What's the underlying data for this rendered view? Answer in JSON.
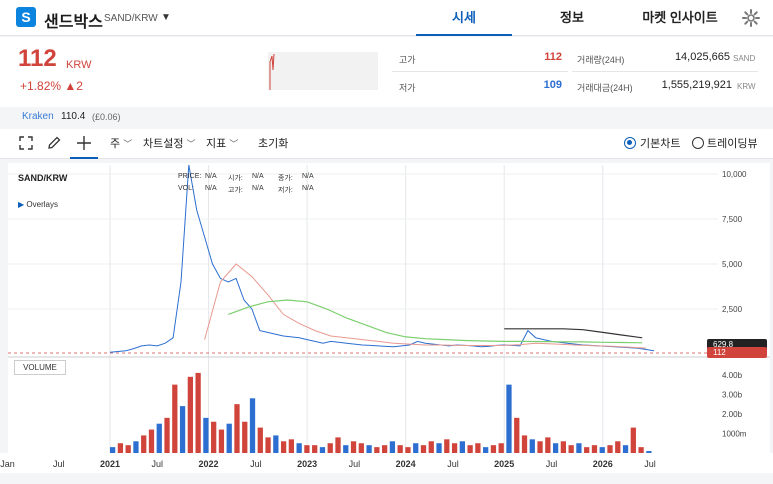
{
  "header": {
    "logo_letter": "S",
    "coin_name": "샌드박스",
    "pair": "SAND/KRW",
    "tabs": [
      {
        "label": "시세",
        "active": true
      },
      {
        "label": "정보",
        "active": false
      },
      {
        "label": "마켓 인사이트",
        "active": false
      }
    ],
    "settings_icon": "gear-icon"
  },
  "summary": {
    "price": "112",
    "price_unit": "KRW",
    "change": "+1.82% ▲2",
    "high_label": "고가",
    "high_value": "112",
    "low_label": "저가",
    "low_value": "109",
    "volume_label": "거래량(24H)",
    "volume_value": "14,025,665",
    "volume_unit": "SAND",
    "amount_label": "거래대금(24H)",
    "amount_value": "1,555,219,921",
    "amount_unit": "KRW"
  },
  "exchange": {
    "name": "Kraken",
    "price": "110.4",
    "diff": "(£0.06)"
  },
  "toolbar": {
    "period": "주",
    "chart_settings": "차트설정",
    "indicators": "지표",
    "reset": "초기화",
    "radio_basic": "기본차트",
    "radio_trading": "트레이딩뷰",
    "colors": {
      "accent": "#0b5fbb",
      "up": "#d0443b",
      "down": "#2c6fd1"
    }
  },
  "chart": {
    "symbol": "SAND/KRW",
    "overlays": "Overlays",
    "ohlc": {
      "price_label": "PRICE:",
      "price": "N/A",
      "open_label": "시가:",
      "open": "N/A",
      "close_label": "종가:",
      "close": "N/A",
      "vol_label": "VOL:",
      "vol": "N/A",
      "high_label": "고가:",
      "high": "N/A",
      "low_label": "저가:",
      "low": "N/A"
    },
    "volume_label": "VOLUME",
    "price_tag_1": "629.8",
    "price_tag_2": "112"
  },
  "chart_data": {
    "type": "line",
    "price_axis_ticks": [
      "10,000",
      "7,500",
      "5,000",
      "2,500"
    ],
    "volume_axis_ticks": [
      "4.00b",
      "3.00b",
      "2.00b",
      "1000m"
    ],
    "x_ticks": [
      "Jan",
      "Jul",
      "2021",
      "Jul",
      "2022",
      "Jul",
      "2023",
      "Jul",
      "2024",
      "Jul",
      "2025",
      "Jul",
      "2026",
      "Jul"
    ],
    "ylim": [
      0,
      10500
    ],
    "series": [
      {
        "x": [
          0,
          4,
          8,
          12,
          16,
          20,
          24,
          28,
          32,
          36,
          40,
          44,
          48,
          52,
          56,
          60,
          64,
          68,
          72,
          76,
          80,
          84,
          88,
          92,
          96,
          100,
          104,
          108,
          112,
          116,
          120,
          124,
          128,
          132,
          136,
          140,
          144,
          148,
          152,
          156,
          160,
          164,
          168,
          172,
          176,
          180,
          184,
          188,
          192,
          196,
          200,
          204,
          208,
          212,
          216,
          220,
          224,
          228,
          232,
          236,
          240,
          244,
          248,
          252,
          256,
          260,
          264,
          268,
          272,
          276
        ],
        "values": [
          100,
          140,
          180,
          300,
          450,
          500,
          450,
          600,
          900,
          4000,
          10500,
          8000,
          6500,
          5000,
          4200,
          4000,
          4200,
          3000,
          2500,
          1300,
          1200,
          1100,
          1000,
          950,
          900,
          800,
          700,
          600,
          700,
          650,
          600,
          550,
          500,
          480,
          450,
          420,
          400,
          450,
          500,
          700,
          600,
          550,
          500,
          450,
          500,
          480,
          450,
          400,
          420,
          480,
          500,
          480,
          450,
          1300,
          900,
          800,
          700,
          650,
          600,
          550,
          500,
          480,
          450,
          420,
          400,
          380,
          350,
          320,
          250,
          180
        ]
      },
      {
        "x": [
          48,
          56,
          64,
          72,
          80,
          88,
          96,
          104,
          112,
          120,
          128,
          136,
          144,
          152,
          160,
          168,
          176,
          184,
          192,
          200,
          208,
          216,
          224,
          232,
          240,
          248,
          256,
          264,
          272
        ],
        "values": [
          800,
          4000,
          5000,
          4300,
          3300,
          2200,
          1700,
          1300,
          1000,
          900,
          800,
          700,
          600,
          550,
          500,
          500,
          480,
          470,
          470,
          480,
          520,
          600,
          560,
          520,
          480,
          450,
          420,
          380,
          330
        ]
      },
      {
        "x": [
          60,
          70,
          80,
          90,
          100,
          110,
          120,
          130,
          140,
          150,
          160,
          170,
          180,
          190,
          200,
          210,
          220,
          230,
          240,
          250,
          260,
          270
        ],
        "values": [
          2200,
          2600,
          2900,
          3000,
          2900,
          2500,
          2000,
          1600,
          1200,
          950,
          850,
          800,
          750,
          720,
          700,
          700,
          690,
          680,
          670,
          650,
          640,
          620
        ]
      },
      {
        "x": [
          200,
          210,
          220,
          230,
          240,
          250,
          260,
          270
        ],
        "values": [
          1400,
          1400,
          1400,
          1400,
          1350,
          1200,
          1050,
          900
        ]
      }
    ],
    "volumes": [
      0.3,
      0.5,
      0.4,
      0.6,
      0.9,
      1.2,
      1.5,
      1.8,
      3.5,
      2.4,
      3.9,
      4.1,
      1.8,
      1.6,
      1.2,
      1.5,
      2.5,
      1.6,
      2.8,
      1.3,
      0.8,
      0.9,
      0.6,
      0.7,
      0.5,
      0.4,
      0.4,
      0.3,
      0.5,
      0.8,
      0.4,
      0.6,
      0.5,
      0.4,
      0.3,
      0.4,
      0.6,
      0.4,
      0.3,
      0.5,
      0.4,
      0.6,
      0.5,
      0.7,
      0.5,
      0.6,
      0.4,
      0.5,
      0.3,
      0.4,
      0.5,
      3.5,
      1.8,
      0.9,
      0.7,
      0.6,
      0.8,
      0.5,
      0.6,
      0.4,
      0.5,
      0.3,
      0.4,
      0.3,
      0.4,
      0.6,
      0.4,
      1.3,
      0.3,
      0.1
    ]
  }
}
